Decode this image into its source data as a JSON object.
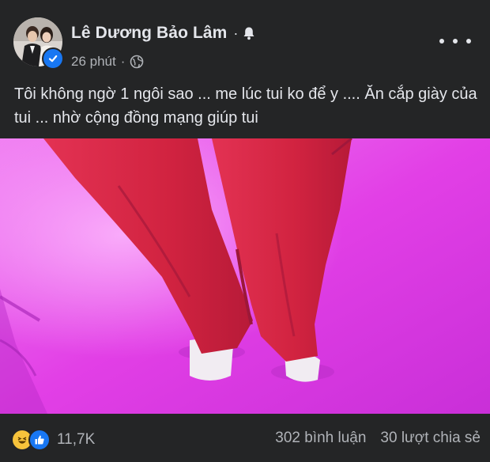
{
  "post": {
    "author_name": "Lê Dương Bảo Lâm",
    "time_label": "26 phút",
    "caption": "Tôi không ngờ 1 ngôi sao ... me lúc tui ko để y .... Ăn cắp giày của tui ... nhờ cộng đồng mạng giúp tui"
  },
  "icons": {
    "bell": "bell-icon",
    "globe": "globe-icon",
    "verified": "verified-badge-icon",
    "more": "more-options-icon",
    "reactions": [
      "haha-reaction-icon",
      "like-reaction-icon"
    ]
  },
  "footer": {
    "reaction_count": "11,7K",
    "comments": "302 bình luận",
    "shares": "30 lượt chia sẻ"
  },
  "colors": {
    "background": "#242526",
    "text_primary": "#e4e6eb",
    "text_secondary": "#b0b3b8",
    "accent_blue": "#1877f2",
    "media_magenta": "#e246e8",
    "pants_red": "#d8253f"
  }
}
